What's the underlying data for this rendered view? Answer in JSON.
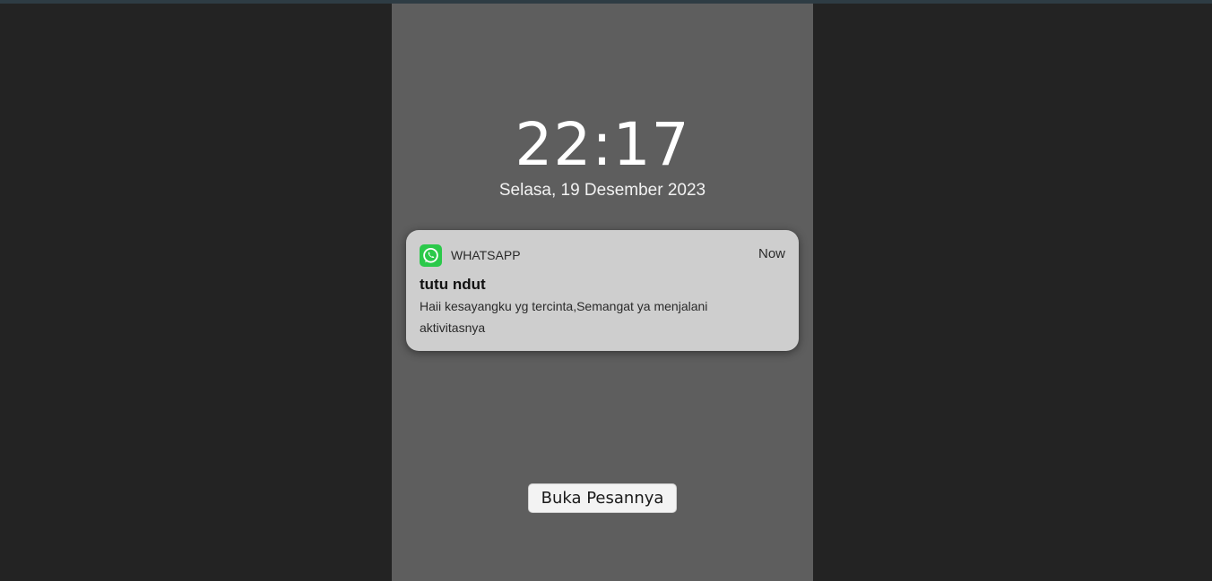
{
  "lockscreen": {
    "time": "22:17",
    "date": "Selasa, 19 Desember 2023"
  },
  "notification": {
    "app_icon": "whatsapp-icon",
    "app_name": "WHATSAPP",
    "time": "Now",
    "sender": "tutu ndut",
    "message": "Haii kesayangku yg tercinta,Semangat ya menjalani aktivitasnya"
  },
  "actions": {
    "open_message_label": "Buka Pesannya"
  },
  "colors": {
    "page_background": "#232323",
    "phone_background": "#5e5e5e",
    "notification_background": "#cecece",
    "whatsapp_green": "#2bc94a"
  }
}
